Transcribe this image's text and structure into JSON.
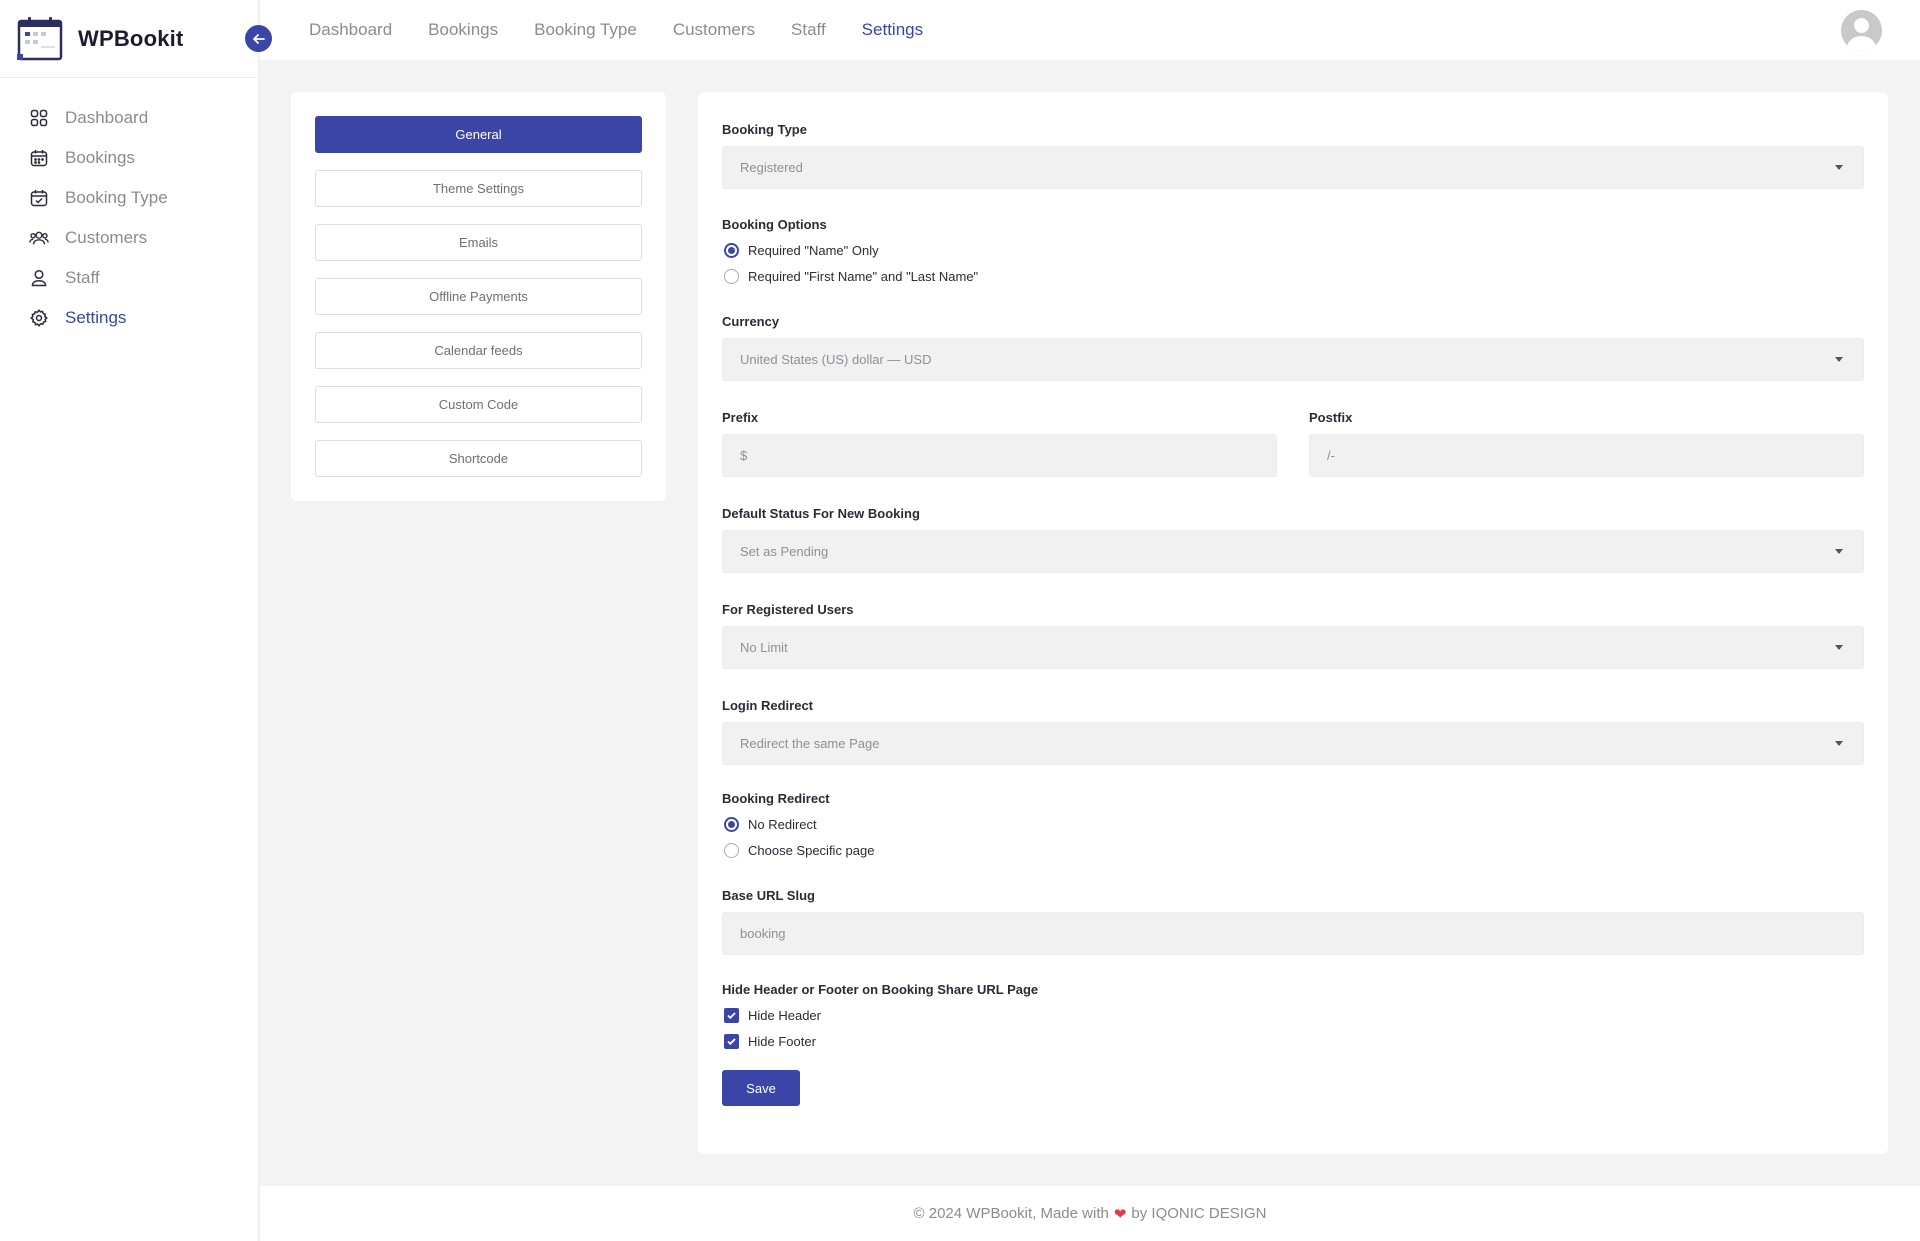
{
  "brand": {
    "name": "WPBookit"
  },
  "sidebar": {
    "items": [
      {
        "label": "Dashboard",
        "icon": "dashboard-grid-icon"
      },
      {
        "label": "Bookings",
        "icon": "calendar-icon"
      },
      {
        "label": "Booking Type",
        "icon": "calendar-check-icon"
      },
      {
        "label": "Customers",
        "icon": "users-icon"
      },
      {
        "label": "Staff",
        "icon": "user-icon"
      },
      {
        "label": "Settings",
        "icon": "gear-icon",
        "active": true
      }
    ]
  },
  "topnav": {
    "items": [
      "Dashboard",
      "Bookings",
      "Booking Type",
      "Customers",
      "Staff",
      "Settings"
    ],
    "active": "Settings"
  },
  "settings_tabs": {
    "items": [
      "General",
      "Theme Settings",
      "Emails",
      "Offline Payments",
      "Calendar feeds",
      "Custom Code",
      "Shortcode"
    ],
    "active": "General"
  },
  "form": {
    "booking_type": {
      "label": "Booking Type",
      "value": "Registered"
    },
    "booking_options": {
      "label": "Booking Options",
      "options": [
        "Required \"Name\" Only",
        "Required \"First Name\" and \"Last Name\""
      ],
      "selected": "Required \"Name\" Only"
    },
    "currency": {
      "label": "Currency",
      "value": "United States (US) dollar — USD"
    },
    "prefix": {
      "label": "Prefix",
      "placeholder": "$"
    },
    "postfix": {
      "label": "Postfix",
      "placeholder": "/-"
    },
    "default_status": {
      "label": "Default Status For New Booking",
      "value": "Set as Pending"
    },
    "registered_users": {
      "label": "For Registered Users",
      "value": "No Limit"
    },
    "login_redirect": {
      "label": "Login Redirect",
      "value": "Redirect the same Page"
    },
    "booking_redirect": {
      "label": "Booking Redirect",
      "options": [
        "No Redirect",
        "Choose Specific page"
      ],
      "selected": "No Redirect"
    },
    "base_url_slug": {
      "label": "Base URL Slug",
      "placeholder": "booking"
    },
    "hide_header_footer": {
      "label": "Hide Header or Footer on Booking Share URL Page",
      "options": [
        {
          "label": "Hide Header",
          "checked": true
        },
        {
          "label": "Hide Footer",
          "checked": true
        }
      ]
    },
    "save_label": "Save"
  },
  "footer": {
    "prefix": "© 2024 WPBookit, Made with",
    "suffix": "by IQONIC DESIGN"
  },
  "colors": {
    "accent": "#3a45a7",
    "heart": "#e53946"
  }
}
